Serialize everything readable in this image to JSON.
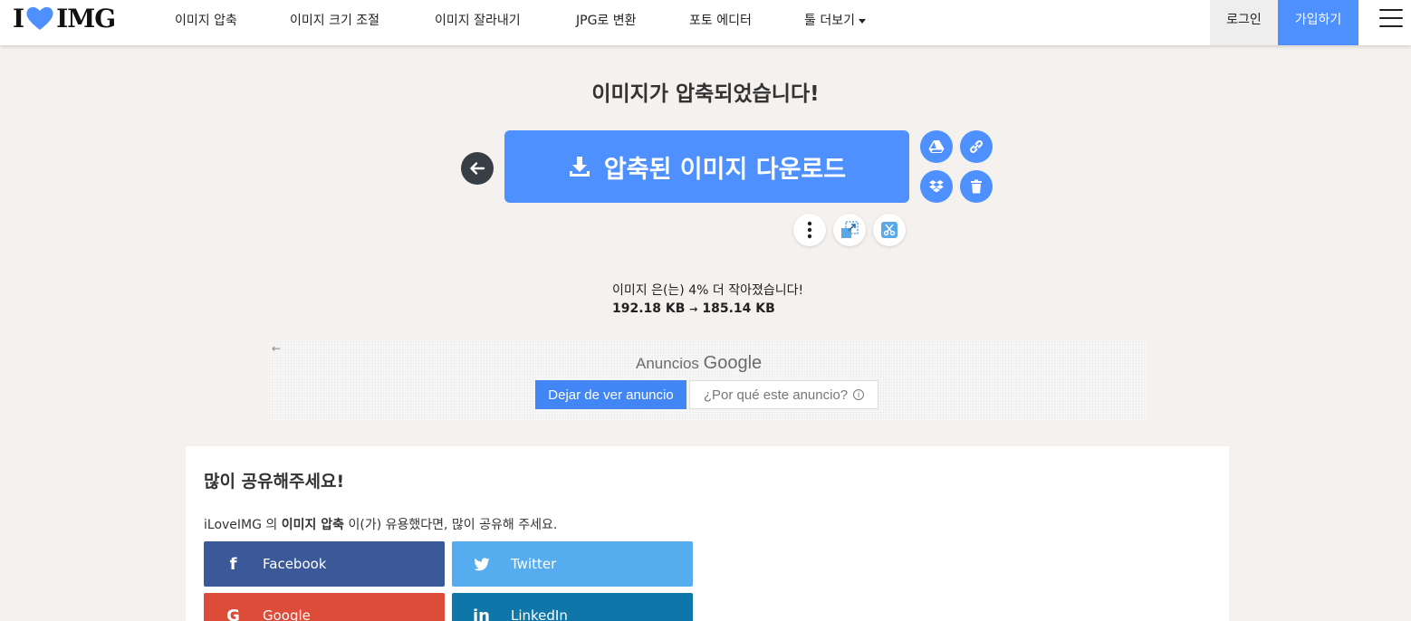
{
  "header": {
    "logo_left": "I",
    "logo_right": "IMG",
    "nav": [
      {
        "label": "이미지 압축"
      },
      {
        "label": "이미지 크기 조절"
      },
      {
        "label": "이미지 잘라내기"
      },
      {
        "label": "JPG로 변환"
      },
      {
        "label": "포토 에디터"
      },
      {
        "label": "툴 더보기"
      }
    ],
    "login": "로그인",
    "signup": "가입하기"
  },
  "main": {
    "title": "이미지가 압축되었습니다!",
    "download_label": "압축된 이미지 다운로드",
    "result_text": "이미지 은(는) 4% 더 작아졌습니다!",
    "size_before": "192.18 KB",
    "size_arrow": "→",
    "size_after": "185.14 KB"
  },
  "ad": {
    "back": "←",
    "label_prefix": "Anuncios",
    "label_brand": "Google",
    "stop": "Dejar de ver anuncio",
    "why": "¿Por qué este anuncio?",
    "info": "i"
  },
  "share": {
    "title": "많이 공유해주세요!",
    "desc_prefix": "iLoveIMG 의",
    "desc_bold": "이미지 압축",
    "desc_suffix": "이(가) 유용했다면, 많이 공유해 주세요.",
    "buttons": [
      {
        "label": "Facebook",
        "icon": "f",
        "color": "#3b5998"
      },
      {
        "label": "Twitter",
        "icon": "t",
        "color": "#55acee"
      },
      {
        "label": "Google",
        "icon": "G",
        "color": "#dd4b39"
      },
      {
        "label": "LinkedIn",
        "icon": "in",
        "color": "#0e76a8"
      }
    ]
  },
  "colors": {
    "accent": "#4d90fe",
    "background": "#f4f1ee",
    "dark_button": "#383e45"
  }
}
